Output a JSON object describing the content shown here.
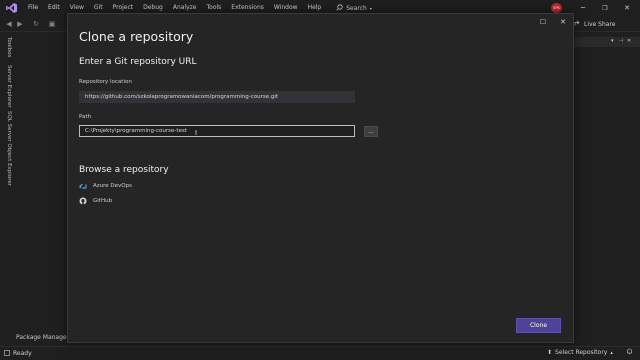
{
  "menubar": {
    "items": [
      "File",
      "Edit",
      "View",
      "Git",
      "Project",
      "Debug",
      "Analyze",
      "Tools",
      "Extensions",
      "Window",
      "Help"
    ],
    "search_label": "Search",
    "avatar_initials": "SPK"
  },
  "toolbar": {
    "live_share_label": "Live Share"
  },
  "side_tabs": [
    "Toolbox",
    "Server Explorer",
    "SQL Server Object Explorer"
  ],
  "dialog": {
    "title": "Clone a repository",
    "url_section_title": "Enter a Git repository URL",
    "repo_location_label": "Repository location",
    "repo_location_value": "https://github.com/szkolaprogramowaniacom/programming-course.git",
    "path_label": "Path",
    "path_value": "C:\\Projekty\\programming-course-test",
    "browse_label": "...",
    "browse_section_title": "Browse a repository",
    "providers": [
      {
        "label": "Azure DevOps",
        "icon": "azure-devops-icon"
      },
      {
        "label": "GitHub",
        "icon": "github-icon"
      }
    ],
    "clone_label": "Clone"
  },
  "bottom": {
    "package_manager_label": "Package Manager C",
    "status_ready": "Ready",
    "select_repository": "Select Repository"
  },
  "colors": {
    "accent": "#4e4396",
    "background": "#1f1f1f",
    "dialog_background": "#252526",
    "avatar": "#c4262e"
  }
}
